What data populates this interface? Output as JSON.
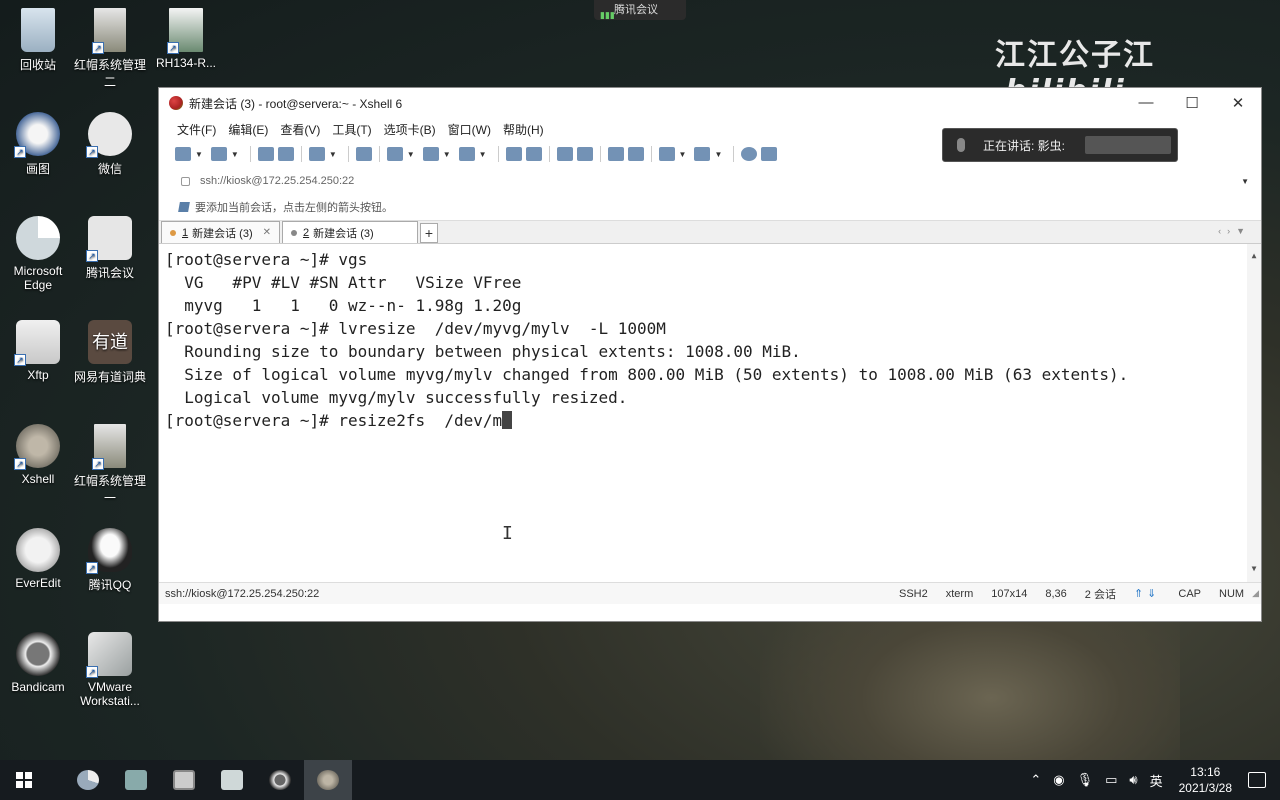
{
  "desktop": {
    "icons": [
      {
        "label": "回收站",
        "icon": "recycle-bin-icon"
      },
      {
        "label": "红帽系统管理二",
        "icon": "document-shortcut-icon"
      },
      {
        "label": "RH134-R...",
        "icon": "document-shortcut-icon"
      },
      {
        "label": "画图",
        "icon": "paint-icon"
      },
      {
        "label": "微信",
        "icon": "wechat-icon"
      },
      {
        "label": "Microsoft Edge",
        "icon": "edge-icon"
      },
      {
        "label": "腾讯会议",
        "icon": "tencent-meeting-icon"
      },
      {
        "label": "Xftp",
        "icon": "xftp-icon"
      },
      {
        "label": "网易有道词典",
        "icon": "youdao-icon"
      },
      {
        "label": "Xshell",
        "icon": "xshell-icon"
      },
      {
        "label": "红帽系统管理一",
        "icon": "document-shortcut-icon"
      },
      {
        "label": "EverEdit",
        "icon": "everedit-icon"
      },
      {
        "label": "腾讯QQ",
        "icon": "qq-icon"
      },
      {
        "label": "Bandicam",
        "icon": "bandicam-icon"
      },
      {
        "label": "VMware Workstati...",
        "icon": "vmware-icon"
      }
    ],
    "watermark": "江江公子江",
    "watermark_brand": "bilibili",
    "meeting_top_label": "腾讯会议"
  },
  "window": {
    "title": "新建会话 (3) - root@servera:~ - Xshell 6",
    "controls": {
      "minimize": "—",
      "maximize": "☐",
      "close": "✕"
    },
    "menu": [
      "文件(F)",
      "编辑(E)",
      "查看(V)",
      "工具(T)",
      "选项卡(B)",
      "窗口(W)",
      "帮助(H)"
    ],
    "address": "ssh://kiosk@172.25.254.250:22",
    "hint": "要添加当前会话，点击左侧的箭头按钮。",
    "tabs": [
      {
        "num": "1",
        "label": "新建会话 (3)",
        "close": "✕"
      },
      {
        "num": "2",
        "label": "新建会话 (3)"
      }
    ],
    "tab_add": "+"
  },
  "terminal": {
    "lines": [
      "[root@servera ~]# vgs",
      "  VG   #PV #LV #SN Attr   VSize VFree",
      "  myvg   1   1   0 wz--n- 1.98g 1.20g",
      "[root@servera ~]# lvresize  /dev/myvg/mylv  -L 1000M",
      "  Rounding size to boundary between physical extents: 1008.00 MiB.",
      "  Size of logical volume myvg/mylv changed from 800.00 MiB (50 extents) to 1008.00 MiB (63 extents).",
      "  Logical volume myvg/mylv successfully resized."
    ],
    "prompt_line": "[root@servera ~]# resize2fs  /dev/m"
  },
  "statusbar": {
    "connection": "ssh://kiosk@172.25.254.250:22",
    "protocol": "SSH2",
    "term": "xterm",
    "size": "107x14",
    "cursor": "8,36",
    "sessions": "2 会话",
    "cap": "CAP",
    "num": "NUM"
  },
  "speaking_popup": {
    "label": "正在讲话: 影虫:"
  },
  "taskbar": {
    "ime": "英",
    "time": "13:16",
    "date": "2021/3/28"
  }
}
